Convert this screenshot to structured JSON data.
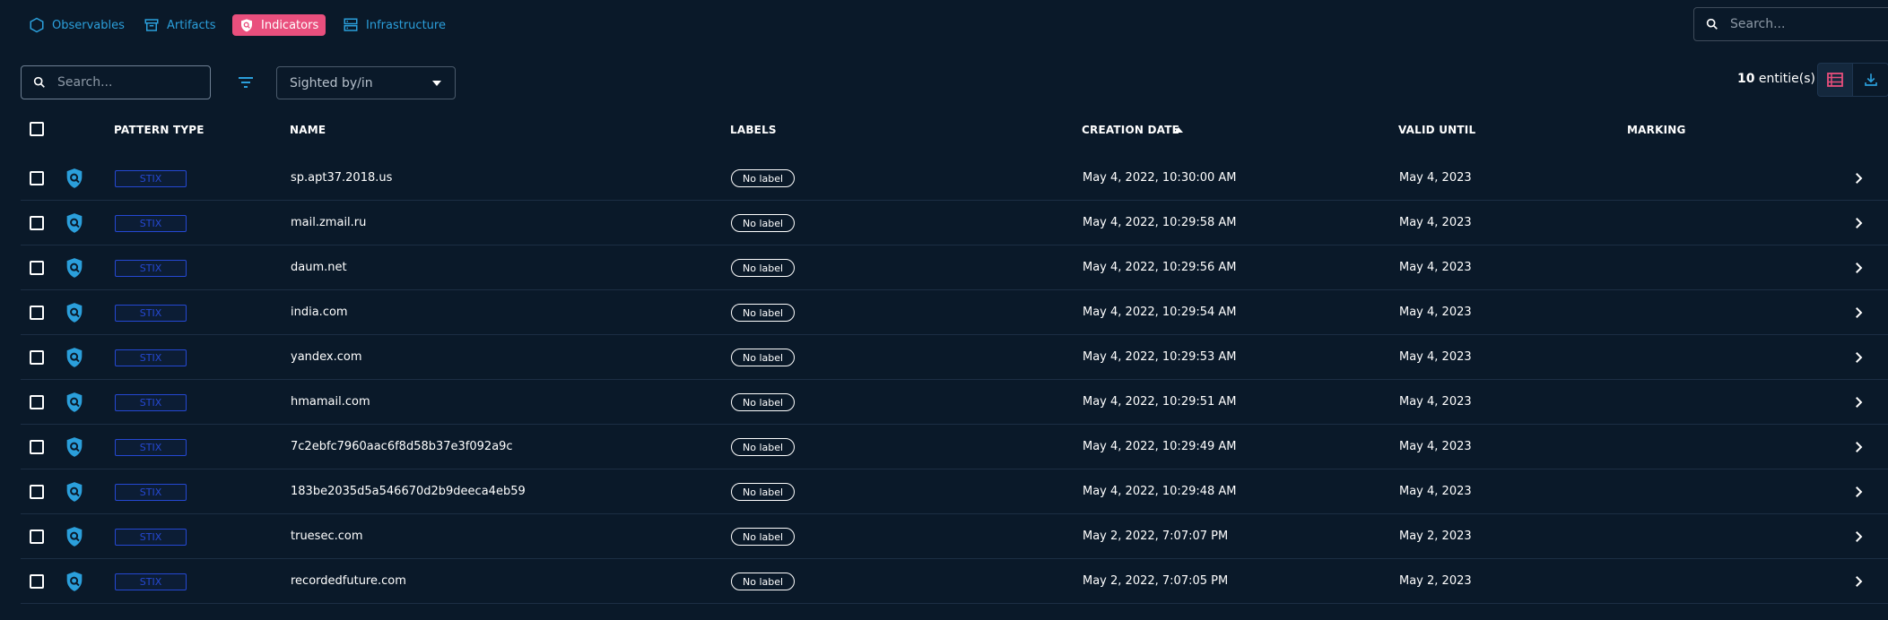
{
  "nav": {
    "items": [
      {
        "label": "Observables",
        "icon": "hexagon-icon",
        "active": false
      },
      {
        "label": "Artifacts",
        "icon": "archive-icon",
        "active": false
      },
      {
        "label": "Indicators",
        "icon": "shield-search-icon",
        "active": true
      },
      {
        "label": "Infrastructure",
        "icon": "server-icon",
        "active": false
      }
    ]
  },
  "top_search": {
    "placeholder": "Search..."
  },
  "filters": {
    "search_placeholder": "Search...",
    "select_value": "Sighted by/in"
  },
  "count": {
    "number": "10",
    "suffix": " entitie(s)"
  },
  "table": {
    "headers": {
      "pattern_type": "PATTERN TYPE",
      "name": "NAME",
      "labels": "LABELS",
      "creation_date": "CREATION DATE",
      "valid_until": "VALID UNTIL",
      "marking": "MARKING"
    },
    "sort": {
      "column": "creation_date",
      "direction": "ascending"
    },
    "rows": [
      {
        "pattern_type": "STIX",
        "name": "sp.apt37.2018.us",
        "label": "No label",
        "creation_date": "May 4, 2022, 10:30:00 AM",
        "valid_until": "May 4, 2023"
      },
      {
        "pattern_type": "STIX",
        "name": "mail.zmail.ru",
        "label": "No label",
        "creation_date": "May 4, 2022, 10:29:58 AM",
        "valid_until": "May 4, 2023"
      },
      {
        "pattern_type": "STIX",
        "name": "daum.net",
        "label": "No label",
        "creation_date": "May 4, 2022, 10:29:56 AM",
        "valid_until": "May 4, 2023"
      },
      {
        "pattern_type": "STIX",
        "name": "india.com",
        "label": "No label",
        "creation_date": "May 4, 2022, 10:29:54 AM",
        "valid_until": "May 4, 2023"
      },
      {
        "pattern_type": "STIX",
        "name": "yandex.com",
        "label": "No label",
        "creation_date": "May 4, 2022, 10:29:53 AM",
        "valid_until": "May 4, 2023"
      },
      {
        "pattern_type": "STIX",
        "name": "hmamail.com",
        "label": "No label",
        "creation_date": "May 4, 2022, 10:29:51 AM",
        "valid_until": "May 4, 2023"
      },
      {
        "pattern_type": "STIX",
        "name": "7c2ebfc7960aac6f8d58b37e3f092a9c",
        "label": "No label",
        "creation_date": "May 4, 2022, 10:29:49 AM",
        "valid_until": "May 4, 2023"
      },
      {
        "pattern_type": "STIX",
        "name": "183be2035d5a546670d2b9deeca4eb59",
        "label": "No label",
        "creation_date": "May 4, 2022, 10:29:48 AM",
        "valid_until": "May 4, 2023"
      },
      {
        "pattern_type": "STIX",
        "name": "truesec.com",
        "label": "No label",
        "creation_date": "May 2, 2022, 7:07:07 PM",
        "valid_until": "May 2, 2023"
      },
      {
        "pattern_type": "STIX",
        "name": "recordedfuture.com",
        "label": "No label",
        "creation_date": "May 2, 2022, 7:07:05 PM",
        "valid_until": "May 2, 2023"
      }
    ]
  },
  "colors": {
    "background": "#0a1929",
    "accent": "#2b9fdb",
    "active_tab": "#e94f7d",
    "stix_badge": "#2548d2"
  }
}
